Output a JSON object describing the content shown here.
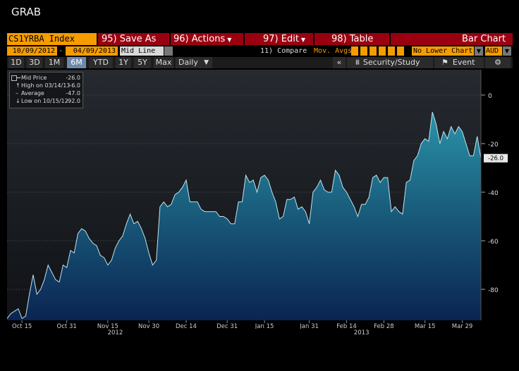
{
  "window": {
    "title": "GRAB"
  },
  "toolbar": {
    "ticker": "CS1YRBA Index",
    "save_as": "95) Save As",
    "actions": "96) Actions",
    "edit": "97) Edit",
    "table": "98) Table",
    "bar_chart": "Bar Chart"
  },
  "controls": {
    "start_date": "10/09/2012",
    "end_date": "04/09/2013",
    "field": "Mid Line",
    "compare": "11) Compare",
    "mov_avgs": "Mov. Avgs",
    "lower_chart": "No Lower Chart",
    "currency": "AUD"
  },
  "tabs": {
    "periods": [
      "1D",
      "3D",
      "1M",
      "6M",
      "YTD",
      "1Y",
      "5Y",
      "Max"
    ],
    "active": "6M",
    "frequency": "Daily",
    "security_study": "Security/Study",
    "event": "Event"
  },
  "legend": {
    "rows": [
      {
        "label": "Mid Price",
        "value": "-26.0"
      },
      {
        "label": "High on 03/14/13",
        "value": "-6.0"
      },
      {
        "label": "Average",
        "value": "-47.0"
      },
      {
        "label": "Low on 10/15/12",
        "value": "-92.0"
      }
    ]
  },
  "chart_data": {
    "type": "area",
    "ylim": [
      -100,
      0
    ],
    "yticks": [
      0,
      -20,
      -40,
      -60,
      -80
    ],
    "ytick_labels": [
      "0",
      "-20",
      "-40",
      "-60",
      "-80"
    ],
    "last_value_label": "-26.0",
    "grid": true,
    "xticks": [
      {
        "label": "Oct 15",
        "index": 4
      },
      {
        "label": "Oct 31",
        "index": 16
      },
      {
        "label": "Nov 15",
        "index": 27
      },
      {
        "label": "Nov 30",
        "index": 38
      },
      {
        "label": "Dec 14",
        "index": 48
      },
      {
        "label": "Dec 31",
        "index": 59
      },
      {
        "label": "Jan 15",
        "index": 69
      },
      {
        "label": "Jan 31",
        "index": 81
      },
      {
        "label": "Feb 14",
        "index": 91
      },
      {
        "label": "Feb 28",
        "index": 101
      },
      {
        "label": "Mar 15",
        "index": 112
      },
      {
        "label": "Mar 29",
        "index": 122
      }
    ],
    "year_labels": [
      {
        "label": "2012",
        "index": 29
      },
      {
        "label": "2013",
        "index": 95
      }
    ],
    "n_points": 128,
    "values": [
      -92,
      -90,
      -89,
      -88,
      -92,
      -91,
      -82,
      -74,
      -82,
      -80,
      -76,
      -70,
      -73,
      -76,
      -77,
      -70,
      -71,
      -64,
      -65,
      -57,
      -55,
      -56,
      -59,
      -61,
      -62,
      -66,
      -67,
      -70,
      -68,
      -63,
      -60,
      -58,
      -53,
      -49,
      -53,
      -52,
      -55,
      -59,
      -65,
      -70,
      -68,
      -46,
      -44,
      -46,
      -45,
      -41,
      -40,
      -38,
      -35,
      -44,
      -44,
      -44,
      -47,
      -48,
      -48,
      -48,
      -48,
      -50,
      -50,
      -51,
      -53,
      -53,
      -44,
      -44,
      -33,
      -36,
      -35,
      -40,
      -34,
      -33,
      -35,
      -40,
      -44,
      -51,
      -50,
      -43,
      -43,
      -42,
      -47,
      -46,
      -48,
      -53,
      -40,
      -38,
      -35,
      -39,
      -40,
      -40,
      -31,
      -33,
      -38,
      -40,
      -43,
      -46,
      -50,
      -45,
      -45,
      -42,
      -34,
      -33,
      -36,
      -34,
      -34,
      -48,
      -46,
      -48,
      -49,
      -36,
      -35,
      -27,
      -25,
      -20,
      -18,
      -19,
      -7,
      -12,
      -20,
      -15,
      -18,
      -13,
      -16,
      -13,
      -15,
      -20,
      -25,
      -25,
      -17,
      -26
    ]
  }
}
